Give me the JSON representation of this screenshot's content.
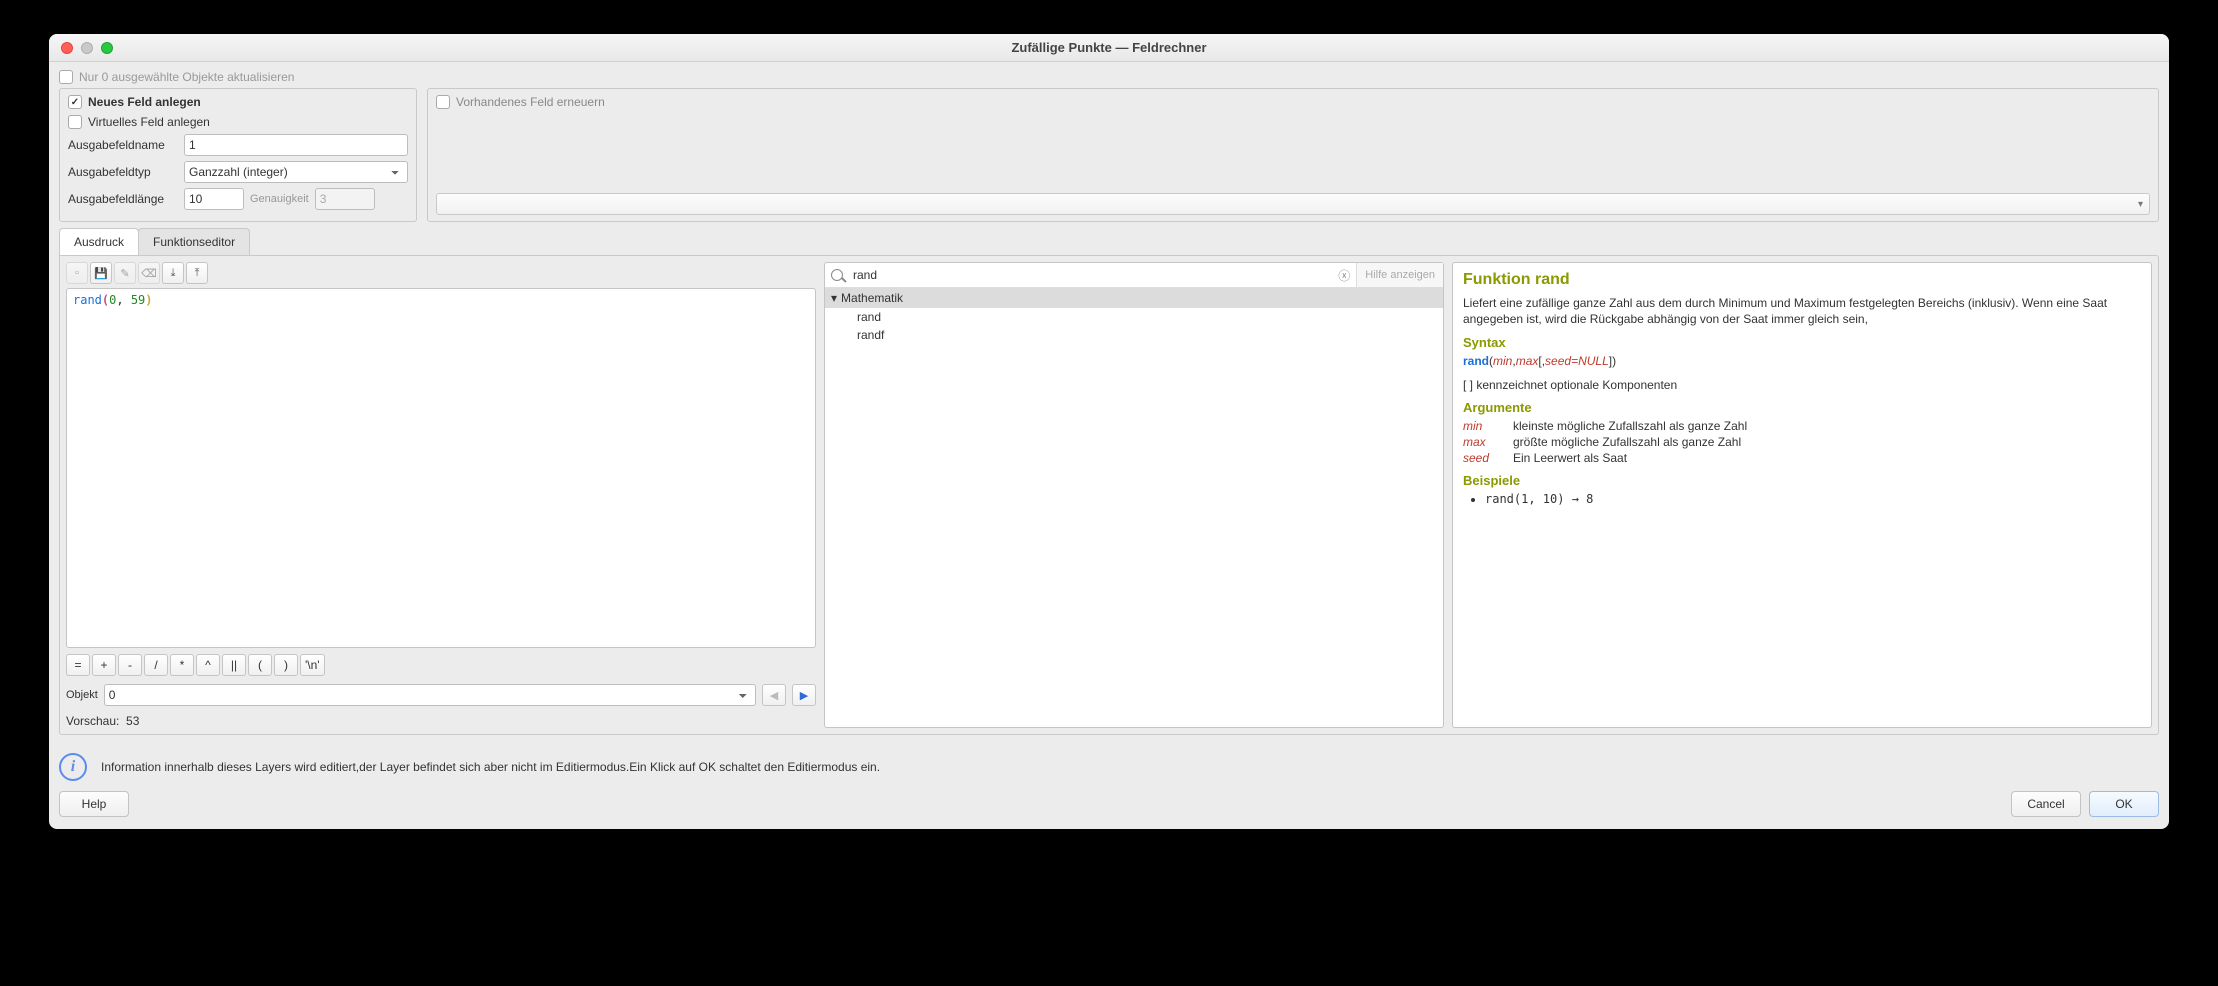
{
  "window": {
    "title": "Zufällige Punkte — Feldrechner"
  },
  "top": {
    "update_label": "Nur 0 ausgewählte Objekte aktualisieren"
  },
  "panel_left": {
    "title": "Neues Feld anlegen",
    "virtual_label": "Virtuelles Feld anlegen",
    "name_label": "Ausgabefeldname",
    "name_value": "1",
    "type_label": "Ausgabefeldtyp",
    "type_value": "Ganzzahl (integer)",
    "len_label": "Ausgabefeldlänge",
    "len_value": "10",
    "prec_label": "Genauigkeit",
    "prec_value": "3"
  },
  "panel_right": {
    "title": "Vorhandenes Feld erneuern"
  },
  "tabs": {
    "expr": "Ausdruck",
    "func": "Funktionseditor"
  },
  "editor": {
    "fn": "rand",
    "arg1": "0",
    "arg2": "59"
  },
  "ops": [
    "=",
    "+",
    "-",
    "/",
    "*",
    "^",
    "||",
    "(",
    ")",
    "'\\n'"
  ],
  "objekt": {
    "label": "Objekt",
    "value": "0"
  },
  "preview": {
    "label": "Vorschau:",
    "value": "53"
  },
  "search": {
    "value": "rand",
    "help": "Hilfe anzeigen",
    "category": "Mathematik",
    "items": [
      "rand",
      "randf"
    ]
  },
  "doc": {
    "title": "Funktion rand",
    "desc": "Liefert eine zufällige ganze Zahl aus dem durch Minimum und Maximum festgelegten Bereichs (inklusiv). Wenn eine Saat angegeben ist, wird die Rückgabe abhängig von der Saat immer gleich sein,",
    "syntax_h": "Syntax",
    "syntax_fn": "rand",
    "syntax_a1": "min",
    "syntax_a2": "max",
    "syntax_a3": "seed=NULL",
    "syntax_note": "[ ] kennzeichnet optionale Komponenten",
    "args_h": "Argumente",
    "args": [
      {
        "n": "min",
        "d": "kleinste mögliche Zufallszahl als ganze Zahl"
      },
      {
        "n": "max",
        "d": "größte mögliche Zufallszahl als ganze Zahl"
      },
      {
        "n": "seed",
        "d": "Ein Leerwert als Saat"
      }
    ],
    "ex_h": "Beispiele",
    "ex": "rand(1, 10) → 8"
  },
  "info": {
    "text": "Information innerhalb dieses Layers wird editiert,der Layer befindet sich aber nicht im Editiermodus.Ein Klick auf OK schaltet den Editiermodus ein."
  },
  "footer": {
    "help": "Help",
    "cancel": "Cancel",
    "ok": "OK"
  }
}
